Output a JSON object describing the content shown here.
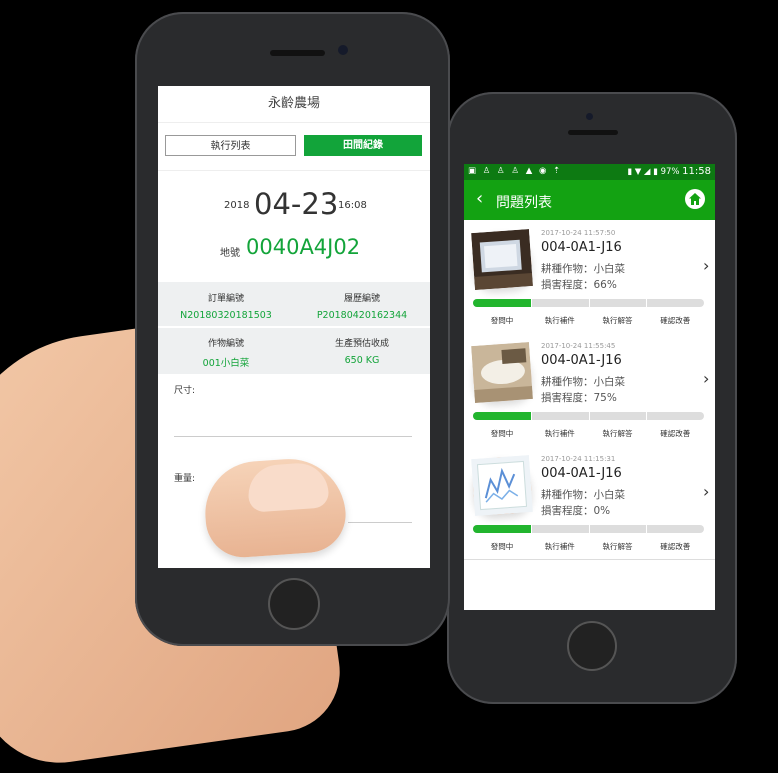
{
  "phone1": {
    "title": "永齡農場",
    "tab_left": "執行列表",
    "tab_right": "田間紀錄",
    "year": "2018",
    "date": "04-23",
    "time": "16:08",
    "location_label": "地號",
    "location_value": "0040A4J02",
    "grid": {
      "order_label": "訂單編號",
      "order_value": "N20180320181503",
      "history_label": "履歷編號",
      "history_value": "P20180420162344",
      "crop_label": "作物編號",
      "crop_value": "001小白菜",
      "yield_label": "生產預估收成",
      "yield_value": "650 KG"
    },
    "size_label": "尺寸:",
    "weight_label": "重量:"
  },
  "phone2": {
    "status": {
      "battery": "97%",
      "clock": "11:58"
    },
    "header_title": "問題列表",
    "stages": [
      "發問中",
      "執行補件",
      "執行解答",
      "確認改善"
    ],
    "cards": [
      {
        "timestamp": "2017-10-24 11:57:50",
        "code": "004-0A1-J16",
        "crop": "耕種作物：小白菜",
        "damage": "損害程度：66%",
        "progress": 0.25
      },
      {
        "timestamp": "2017-10-24 11:55:45",
        "code": "004-0A1-J16",
        "crop": "耕種作物：小白菜",
        "damage": "損害程度：75%",
        "progress": 0.25
      },
      {
        "timestamp": "2017-10-24 11:15:31",
        "code": "004-0A1-J16",
        "crop": "耕種作物：小白菜",
        "damage": "損害程度：0%",
        "progress": 0.25
      }
    ]
  },
  "colors": {
    "brand_green": "#13a43a",
    "header_green": "#13a212",
    "status_green": "#0d7a12"
  }
}
